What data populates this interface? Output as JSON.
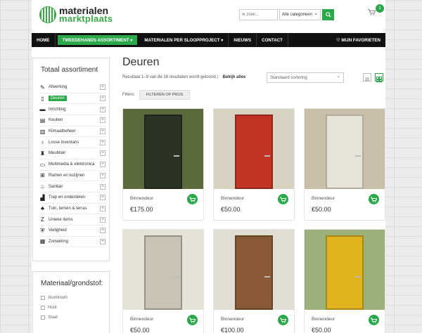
{
  "header": {
    "logo_line1": "materialen",
    "logo_line2": "marktplaats",
    "search_placeholder": "Ik zoek...",
    "category_select": "Alle categorieen",
    "cart_count": "1"
  },
  "nav": [
    {
      "label": "HOME"
    },
    {
      "label": "TWEEDEHANDS ASSORTIMENT ▾"
    },
    {
      "label": "MATERIALEN PER SLOOPPROJECT ▾"
    },
    {
      "label": "NIEUWS"
    },
    {
      "label": "CONTACT"
    }
  ],
  "favorites_label": "♡ MIJN FAVORIETEN",
  "sidebar": {
    "title": "Totaal assortiment",
    "items": [
      {
        "label": "Afwerking",
        "icon": "paint-roller-icon",
        "glyph": "✎"
      },
      {
        "label": "Deuren",
        "icon": "door-icon",
        "glyph": "▯"
      },
      {
        "label": "Inrichting",
        "icon": "sofa-icon",
        "glyph": "▬"
      },
      {
        "label": "Keuken",
        "icon": "kitchen-icon",
        "glyph": "▤"
      },
      {
        "label": "Klimaatbeheer",
        "icon": "radiator-icon",
        "glyph": "▥"
      },
      {
        "label": "Losse inventaris",
        "icon": "bulb-icon",
        "glyph": "♁"
      },
      {
        "label": "Meubilair",
        "icon": "chair-icon",
        "glyph": "♜"
      },
      {
        "label": "Multimedia & elektronica",
        "icon": "monitor-icon",
        "glyph": "▭"
      },
      {
        "label": "Ramen en kozijnen",
        "icon": "window-icon",
        "glyph": "⊞"
      },
      {
        "label": "Sanitair",
        "icon": "toilet-icon",
        "glyph": "♨"
      },
      {
        "label": "Trap en onderdelen",
        "icon": "stairs-icon",
        "glyph": "▟"
      },
      {
        "label": "Tuin, terrein & terras",
        "icon": "tree-icon",
        "glyph": "♣"
      },
      {
        "label": "Unieke items",
        "icon": "star-icon",
        "glyph": "Z"
      },
      {
        "label": "Veiligheid",
        "icon": "shield-icon",
        "glyph": "⛨"
      },
      {
        "label": "Zonwering",
        "icon": "blind-icon",
        "glyph": "▦"
      }
    ],
    "material_title": "Materiaal/grondstof:",
    "materials": [
      {
        "label": "Aluminium"
      },
      {
        "label": "Hout"
      },
      {
        "label": "Staal"
      }
    ]
  },
  "main": {
    "title": "Deuren",
    "results": "Resultaat 1–9 van de 18 resultaten wordt getoond",
    "see_all": "Bekijk alles",
    "sort": "Standaard sortering",
    "filters_label": "Filters:",
    "filter_button": "FILTEREN OP PRIJS",
    "products": [
      {
        "name": "Binnendeur",
        "price": "€175.00",
        "bg": "#5a6a3a",
        "door": "#2b3324"
      },
      {
        "name": "Binnendeur",
        "price": "€50.00",
        "bg": "#d8d2c2",
        "door": "#c23424"
      },
      {
        "name": "Binnendeur",
        "price": "€50.00",
        "bg": "#c9bfa8",
        "door": "#e8e4da"
      },
      {
        "name": "Binnendeur",
        "price": "€50.00",
        "bg": "#e6e2d6",
        "door": "#c9c3b3"
      },
      {
        "name": "Binnendeur",
        "price": "€100.00",
        "bg": "#e2ddd2",
        "door": "#8a5a36"
      },
      {
        "name": "Binnendeur",
        "price": "€50.00",
        "bg": "#9bb07a",
        "door": "#e0b41e"
      }
    ]
  },
  "colors": {
    "accent": "#2ba84a"
  }
}
